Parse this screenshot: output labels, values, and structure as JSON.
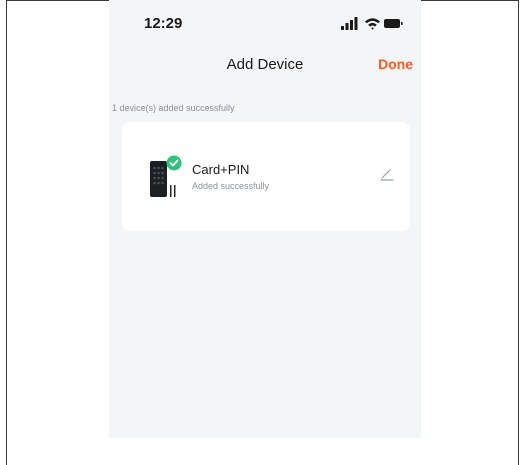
{
  "status_bar": {
    "time": "12:29",
    "icons": [
      "signal-icon",
      "wifi-icon",
      "battery-icon"
    ]
  },
  "nav": {
    "title": "Add Device",
    "done_label": "Done"
  },
  "summary_text": "1 device(s) added successfully",
  "devices": [
    {
      "name": "Card+PIN",
      "status": "Added successfully",
      "icon": "keypad-device-icon",
      "badge_icon": "check-circle-icon"
    }
  ],
  "colors": {
    "accent": "#ff5a1f",
    "success": "#2ec27e",
    "background": "#f4f5f7",
    "card": "#ffffff"
  }
}
